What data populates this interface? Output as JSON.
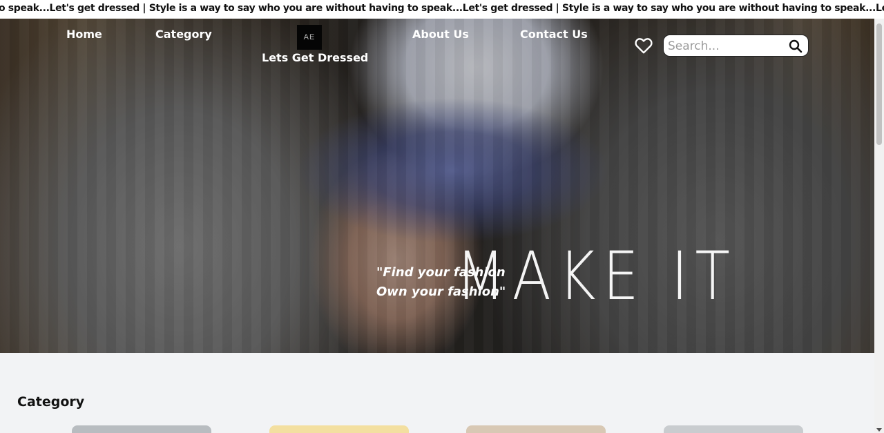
{
  "marquee": {
    "text": "o speak...Let's get dressed | Style is a way to say who you are without having to speak...Let's get dressed | Style is a way to say who you are without having to speak...Let's get dressed | Style is a way to"
  },
  "nav": {
    "home": "Home",
    "category": "Category",
    "about": "About Us",
    "contact": "Contact Us"
  },
  "logo": {
    "mark": "AE",
    "name": "Lets Get Dressed"
  },
  "search": {
    "placeholder": "Search..."
  },
  "icons": {
    "wishlist": "heart-icon",
    "search": "search-icon"
  },
  "hero": {
    "quote_line1": "\"Find your fashion",
    "quote_line2": "Own your fashion\"",
    "headline": "MAKE IT"
  },
  "category_section": {
    "title": "Category",
    "cards": [
      {
        "name": "category-card-1",
        "color": "#b8bcc0"
      },
      {
        "name": "category-card-2",
        "color": "#f3dfa0"
      },
      {
        "name": "category-card-3",
        "color": "#d8c8b4"
      },
      {
        "name": "category-card-4",
        "color": "#c9cccf"
      }
    ]
  },
  "colors": {
    "marquee_bg": "#ffffff",
    "page_bg": "#f2f3f5",
    "text_light": "#ffffff"
  }
}
